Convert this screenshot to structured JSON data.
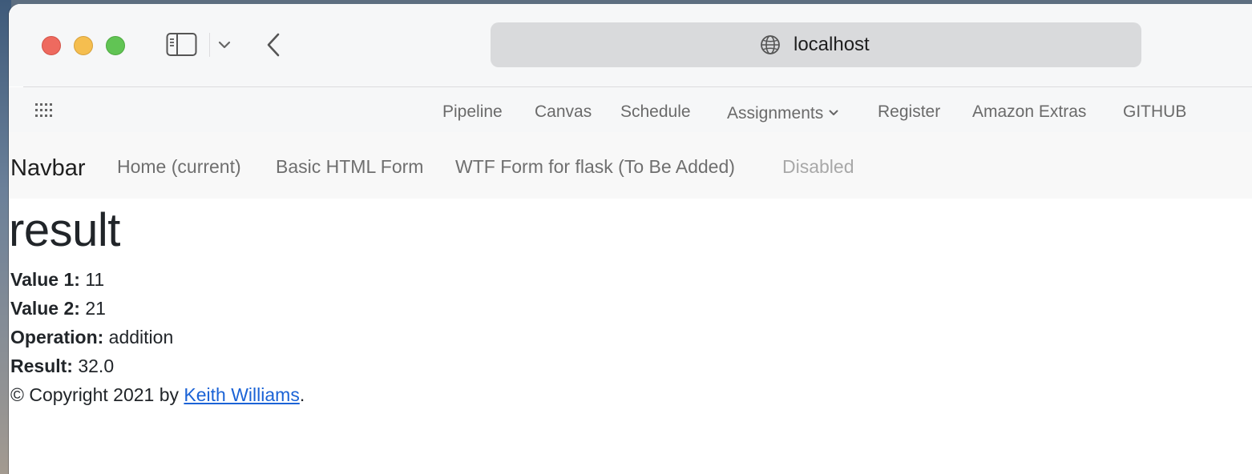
{
  "browser": {
    "address": "localhost",
    "bookmarks": [
      "Pipeline",
      "Canvas",
      "Schedule",
      "Assignments",
      "Register",
      "Amazon Extras",
      "GITHUB"
    ]
  },
  "navbar": {
    "brand": "Navbar",
    "links": [
      "Home (current)",
      "Basic HTML Form",
      "WTF Form for flask (To Be Added)",
      "Disabled"
    ]
  },
  "main": {
    "title": "result",
    "value1_label": "Value 1:",
    "value1": "11",
    "value2_label": "Value 2:",
    "value2": "21",
    "operation_label": "Operation:",
    "operation": "addition",
    "result_label": "Result:",
    "result": "32.0",
    "copyright_prefix": "© Copyright 2021 by",
    "author": "Keith Williams",
    "copyright_suffix": "."
  },
  "colors": {
    "link": "#1b63d6",
    "traffic_red": "#ee6a5f",
    "traffic_yellow": "#f5be4f",
    "traffic_green": "#61c454"
  },
  "icons": [
    "sidebar-icon",
    "chevron-down-icon",
    "back-arrow-icon",
    "globe-icon",
    "grid-icon"
  ]
}
